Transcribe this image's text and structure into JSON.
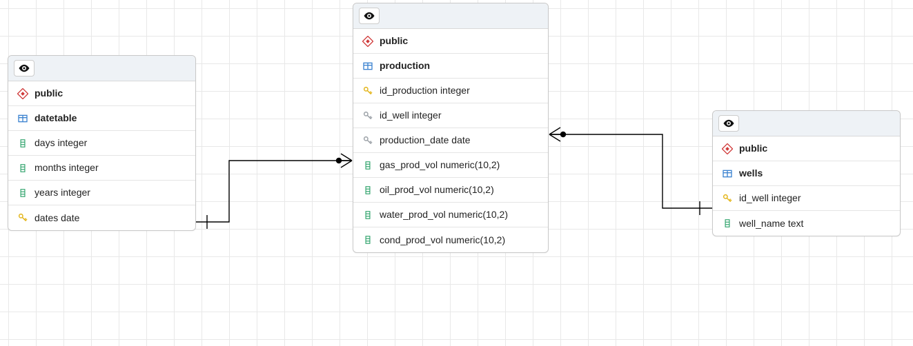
{
  "tables": {
    "datetable": {
      "schema": "public",
      "name": "datetable",
      "columns": [
        {
          "icon": "column",
          "label": "days integer"
        },
        {
          "icon": "column",
          "label": "months integer"
        },
        {
          "icon": "column",
          "label": "years integer"
        },
        {
          "icon": "pk",
          "label": "dates date"
        }
      ]
    },
    "production": {
      "schema": "public",
      "name": "production",
      "columns": [
        {
          "icon": "pk",
          "label": "id_production integer"
        },
        {
          "icon": "fk",
          "label": "id_well integer"
        },
        {
          "icon": "fk",
          "label": "production_date date"
        },
        {
          "icon": "column",
          "label": "gas_prod_vol numeric(10,2)"
        },
        {
          "icon": "column",
          "label": "oil_prod_vol numeric(10,2)"
        },
        {
          "icon": "column",
          "label": "water_prod_vol numeric(10,2)"
        },
        {
          "icon": "column",
          "label": "cond_prod_vol numeric(10,2)"
        }
      ]
    },
    "wells": {
      "schema": "public",
      "name": "wells",
      "columns": [
        {
          "icon": "pk",
          "label": "id_well integer"
        },
        {
          "icon": "column",
          "label": "well_name text"
        }
      ]
    }
  }
}
